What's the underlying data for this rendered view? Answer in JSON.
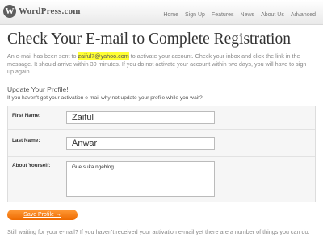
{
  "header": {
    "logo_letter": "W",
    "logo_text": "WordPress.com",
    "nav": [
      "Home",
      "Sign Up",
      "Features",
      "News",
      "About Us",
      "Advanced"
    ]
  },
  "page": {
    "title": "Check Your E-mail to Complete Registration",
    "intro_before": "An e-mail has been sent to ",
    "email": "zaiful7@yahoo.com",
    "intro_after": " to activate your account. Check your inbox and click the link in the message. It should arrive within 30 minutes. If you do not activate your account within two days, you will have to sign up again."
  },
  "profile": {
    "heading": "Update Your Profile!",
    "subheading": "If you haven't got your activation e-mail why not update your profile while you wait?",
    "first_name_label": "First Name:",
    "first_name_value": "Zaiful",
    "last_name_label": "Last Name:",
    "last_name_value": "Anwar",
    "about_label": "About Yourself:",
    "about_value": "Gue suka ngeblog",
    "save_label": "Save Profile →"
  },
  "footer_text": "Still waiting for your e-mail? If you haven't received your activation e-mail yet there are a number of things you can do:",
  "colors": {
    "button": "#ee6a00",
    "highlight": "#ffff33"
  }
}
